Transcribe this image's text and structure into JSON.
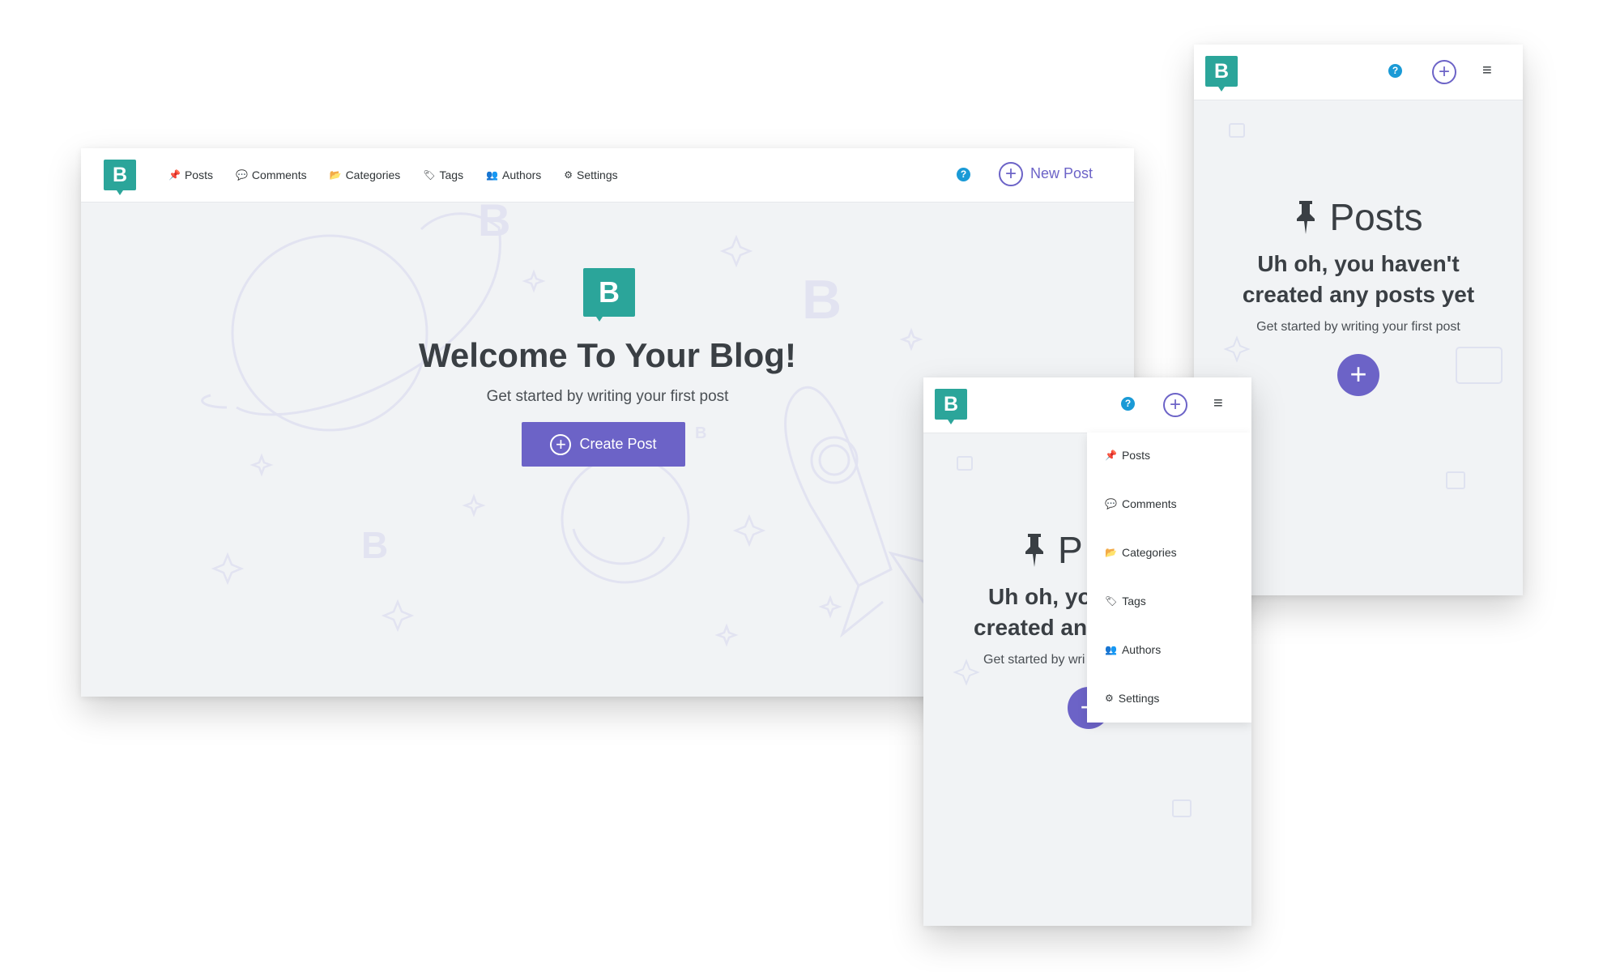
{
  "brand": {
    "logo_letter": "B",
    "color": "#2ba59a",
    "accent": "#6c63c7",
    "help_color": "#1a9ad6"
  },
  "desktop": {
    "nav": [
      {
        "icon": "pin-icon",
        "glyph": "📌",
        "label": "Posts"
      },
      {
        "icon": "comment-icon",
        "glyph": "💬",
        "label": "Comments"
      },
      {
        "icon": "folder-icon",
        "glyph": "📂",
        "label": "Categories"
      },
      {
        "icon": "tags-icon",
        "glyph": "🏷",
        "label": "Tags"
      },
      {
        "icon": "users-icon",
        "glyph": "👥",
        "label": "Authors"
      },
      {
        "icon": "gear-icon",
        "glyph": "⚙",
        "label": "Settings"
      }
    ],
    "help_glyph": "?",
    "new_post_label": "New Post",
    "welcome_title": "Welcome To Your Blog!",
    "welcome_subtitle": "Get started by writing your first post",
    "create_button_label": "Create Post"
  },
  "tablet": {
    "help_glyph": "?",
    "menu_glyph": "≡",
    "posts_heading": "Posts",
    "empty_title_line1": "Uh oh, you haven't",
    "empty_title_line2": "created any posts yet",
    "empty_subtitle": "Get started by writing your first post",
    "fab_glyph": "+"
  },
  "mobile": {
    "help_glyph": "?",
    "menu_glyph": "≡",
    "posts_heading": "P",
    "empty_title_line1": "Uh oh, yo",
    "empty_title_line2": "created an",
    "empty_subtitle": "Get started by wri",
    "dropdown": [
      {
        "icon": "pin-icon",
        "glyph": "📌",
        "label": "Posts"
      },
      {
        "icon": "comment-icon",
        "glyph": "💬",
        "label": "Comments"
      },
      {
        "icon": "folder-icon",
        "glyph": "📂",
        "label": "Categories"
      },
      {
        "icon": "tags-icon",
        "glyph": "🏷",
        "label": "Tags"
      },
      {
        "icon": "users-icon",
        "glyph": "👥",
        "label": "Authors"
      },
      {
        "icon": "gear-icon",
        "glyph": "⚙",
        "label": "Settings"
      }
    ]
  }
}
